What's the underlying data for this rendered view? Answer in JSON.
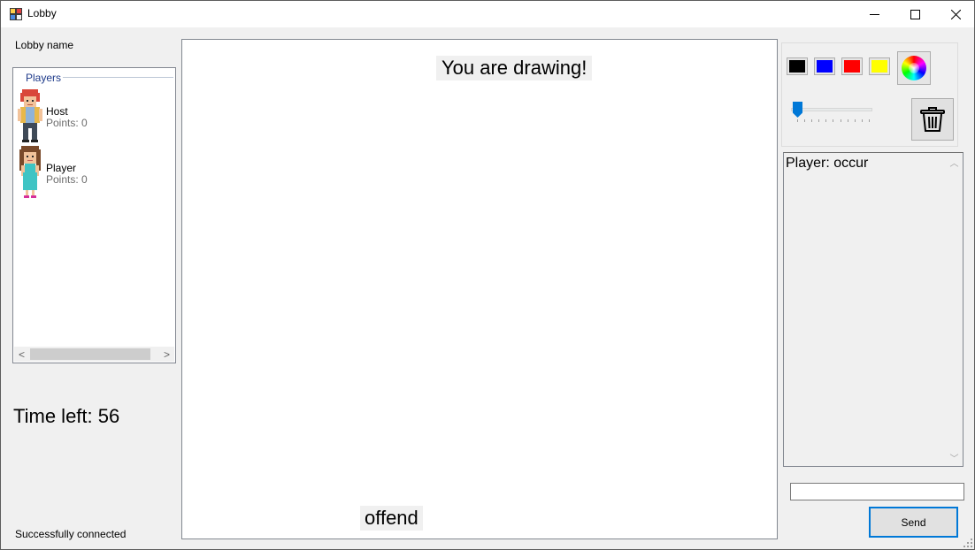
{
  "window": {
    "title": "Lobby",
    "controls": {
      "minimize": "—",
      "maximize": "☐",
      "close": "✕"
    }
  },
  "lobby": {
    "name_label": "Lobby name"
  },
  "players_panel": {
    "legend": "Players",
    "players": [
      {
        "name": "Host",
        "points": "Points: 0",
        "avatar": "red-haired-boy-sprite"
      },
      {
        "name": "Player",
        "points": "Points: 0",
        "avatar": "brown-haired-girl-sprite"
      }
    ],
    "scroll_left": "<",
    "scroll_right": ">"
  },
  "timer": {
    "text": "Time left: 56"
  },
  "status": {
    "text": "Successfully connected"
  },
  "canvas": {
    "drawing_message": "You are drawing!",
    "word": "offend"
  },
  "tools": {
    "colors": [
      {
        "name": "black",
        "hex": "#000000"
      },
      {
        "name": "blue",
        "hex": "#0000ff"
      },
      {
        "name": "red",
        "hex": "#ff0000"
      },
      {
        "name": "yellow",
        "hex": "#ffff00"
      }
    ],
    "color_picker_icon": "color-wheel-icon",
    "brush_size_level": 0,
    "trash_icon": "trash-icon"
  },
  "chat": {
    "messages": [
      "Player: occur"
    ],
    "input_value": "",
    "send_label": "Send"
  }
}
